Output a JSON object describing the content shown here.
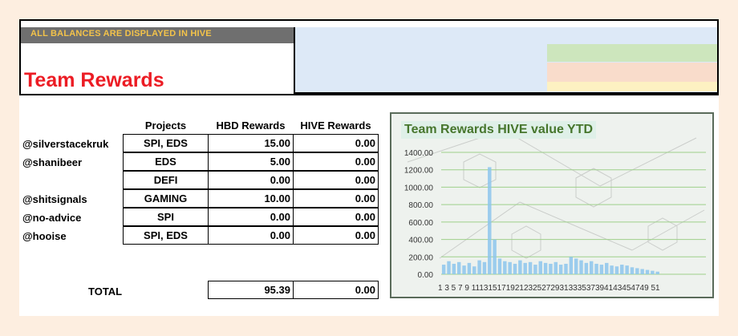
{
  "banner": {
    "note": "ALL BALANCES ARE DISPLAYED IN HIVE"
  },
  "title": "Team Rewards",
  "headers": {
    "projects": "Projects",
    "hbd": "HBD Rewards",
    "hive": "HIVE Rewards"
  },
  "rows": [
    {
      "user": "@silverstacekruk",
      "project": "SPI, EDS",
      "hbd": "15.00",
      "hive": "0.00"
    },
    {
      "user": "@shanibeer",
      "project": "EDS",
      "hbd": "5.00",
      "hive": "0.00"
    },
    {
      "user": "",
      "project": "DEFI",
      "hbd": "0.00",
      "hive": "0.00"
    },
    {
      "user": "@shitsignals",
      "project": "GAMING",
      "hbd": "10.00",
      "hive": "0.00"
    },
    {
      "user": "@no-advice",
      "project": "SPI",
      "hbd": "0.00",
      "hive": "0.00"
    },
    {
      "user": "@hooise",
      "project": "SPI, EDS",
      "hbd": "0.00",
      "hive": "0.00"
    }
  ],
  "total": {
    "label": "TOTAL",
    "hbd": "95.39",
    "hive": "0.00"
  },
  "chart_data": {
    "type": "bar",
    "title": "Team Rewards HIVE value YTD",
    "ylim": [
      0,
      1400
    ],
    "yticks": [
      "1400.00",
      "1200.00",
      "1000.00",
      "800.00",
      "600.00",
      "400.00",
      "200.00",
      "0.00"
    ],
    "x_tick_labels": "1 3 5 7 9 1113151719212325272931333537394143454749 51",
    "x": [
      1,
      2,
      3,
      4,
      5,
      6,
      7,
      8,
      9,
      10,
      11,
      12,
      13,
      14,
      15,
      16,
      17,
      18,
      19,
      20,
      21,
      22,
      23,
      24,
      25,
      26,
      27,
      28,
      29,
      30,
      31,
      32,
      33,
      34,
      35,
      36,
      37,
      38,
      39,
      40,
      41,
      42,
      43,
      44,
      45,
      46,
      47,
      48,
      49,
      50,
      51,
      52
    ],
    "values": [
      110,
      150,
      120,
      140,
      100,
      130,
      90,
      160,
      140,
      1230,
      400,
      180,
      150,
      140,
      120,
      160,
      130,
      140,
      110,
      150,
      130,
      120,
      140,
      110,
      120,
      200,
      180,
      160,
      130,
      150,
      120,
      110,
      130,
      100,
      90,
      110,
      100,
      80,
      70,
      60,
      50,
      40,
      30,
      0,
      0,
      0,
      0,
      0,
      0,
      0,
      0,
      0
    ],
    "colors": {
      "bar": "#8cc6ec",
      "grid": "#9ed08a"
    }
  }
}
